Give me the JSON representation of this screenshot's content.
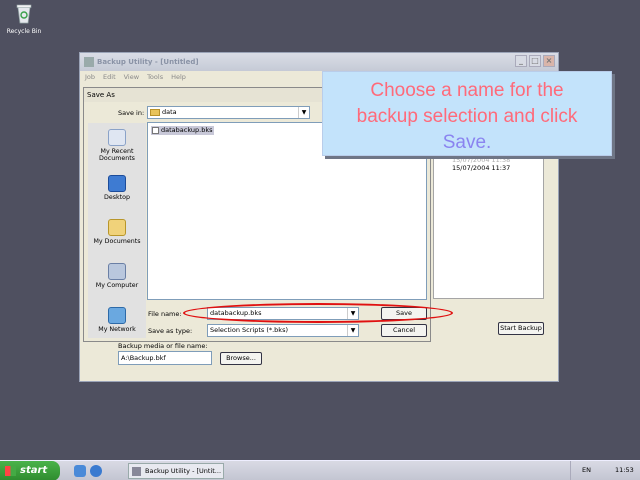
{
  "desktop": {
    "recycle_bin_label": "Recycle Bin"
  },
  "window": {
    "title": "Backup Utility - [Untitled]",
    "controls": {
      "minimize": "_",
      "maximize": "□",
      "close": "×"
    },
    "menu": [
      "Job",
      "Edit",
      "View",
      "Tools",
      "Help"
    ],
    "timestamps": [
      "15/07/2004 11:38",
      "15/07/2004 11:37"
    ],
    "start_backup_label": "Start Backup",
    "backup_media_label": "Backup media or file name:",
    "backup_media_value": "A:\\Backup.bkf",
    "browse_label": "Browse..."
  },
  "dialog": {
    "title": "Save As",
    "save_in_label": "Save in:",
    "save_in_value": "data",
    "places": [
      {
        "icon": "recent-documents-icon",
        "label": "My Recent Documents"
      },
      {
        "icon": "desktop-icon",
        "label": "Desktop"
      },
      {
        "icon": "my-documents-icon",
        "label": "My Documents"
      },
      {
        "icon": "my-computer-icon",
        "label": "My Computer"
      },
      {
        "icon": "my-network-icon",
        "label": "My Network"
      }
    ],
    "file_item": "databackup.bks",
    "file_name_label": "File name:",
    "file_name_value": "databackup.bks",
    "save_as_type_label": "Save as type:",
    "save_as_type_value": "Selection Scripts (*.bks)",
    "save_button": "Save",
    "cancel_button": "Cancel"
  },
  "callout": {
    "line1": "Choose a name for the",
    "line2": "backup selection and click",
    "line3": "Save."
  },
  "taskbar": {
    "start_label": "start",
    "task_label": "Backup Utility - [Untit...",
    "language": "EN",
    "clock": "11:53"
  },
  "colors": {
    "desktop_bg": "#4f5060",
    "callout_bg": "#c3e3fb",
    "callout_text": "#ff6a7a",
    "highlight": "#e01010"
  }
}
